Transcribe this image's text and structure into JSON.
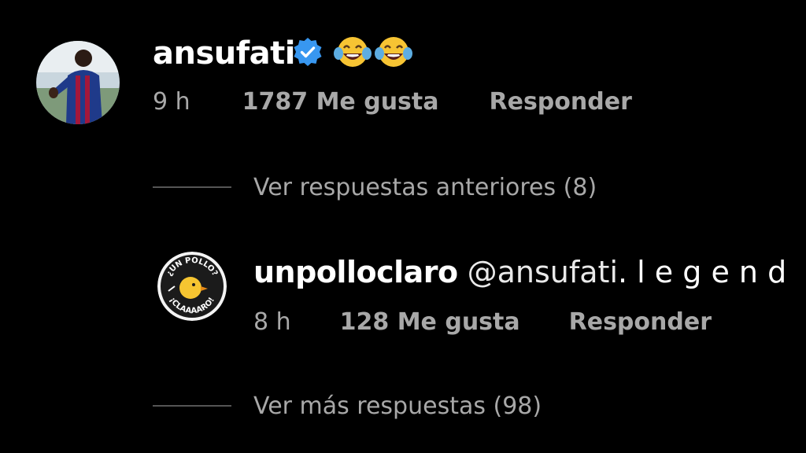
{
  "comment": {
    "username": "ansufati",
    "verified": true,
    "emojis": [
      "😂",
      "😂"
    ],
    "time": "9 h",
    "likes": "1787 Me gusta",
    "reply": "Responder"
  },
  "previous_replies": "Ver respuestas anteriores (8)",
  "reply": {
    "username": "unpolloclaro",
    "mention": "@ansufati",
    "text": ". l e g e n d",
    "time": "8 h",
    "likes": "128 Me gusta",
    "reply": "Responder",
    "avatar_text_top": "¿UN POLLO?",
    "avatar_text_bottom": "¡CLAAAARO!"
  },
  "more_replies": "Ver más respuestas (98)",
  "colors": {
    "background": "#000000",
    "primary_text": "#ffffff",
    "secondary_text": "#a8a8a8",
    "verified_badge": "#3897f0",
    "chick": "#f6c531"
  }
}
